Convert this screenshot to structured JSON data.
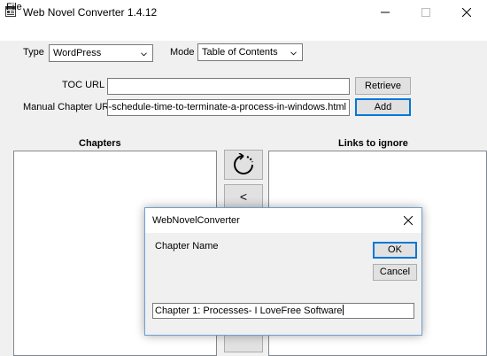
{
  "window": {
    "title": "Web Novel Converter 1.4.12",
    "icon": "app-icon",
    "controls": [
      "minimize-icon",
      "maximize-icon",
      "close-icon"
    ]
  },
  "menu": {
    "file": "File"
  },
  "form": {
    "type_label": "Type",
    "type_value": "WordPress",
    "mode_label": "Mode",
    "mode_value": "Table of Contents",
    "toc_label": "TOC URL",
    "toc_value": "",
    "retrieve_label": "Retrieve",
    "manual_label": "Manual Chapter URL",
    "manual_value": "orial/how-to-schedule-time-to-terminate-a-process-in-windows.html",
    "add_label": "Add"
  },
  "lists": {
    "chapters_heading": "Chapters",
    "ignore_heading": "Links to ignore",
    "refresh_icon": "refresh-icon",
    "move_left_label": "<"
  },
  "dialog": {
    "title": "WebNovelConverter",
    "prompt": "Chapter Name",
    "ok_label": "OK",
    "cancel_label": "Cancel",
    "input_value": "Chapter 1: Processes- I LoveFree Software"
  },
  "colors": {
    "accent": "#0078d7",
    "window_bg": "#f0f0f0"
  }
}
